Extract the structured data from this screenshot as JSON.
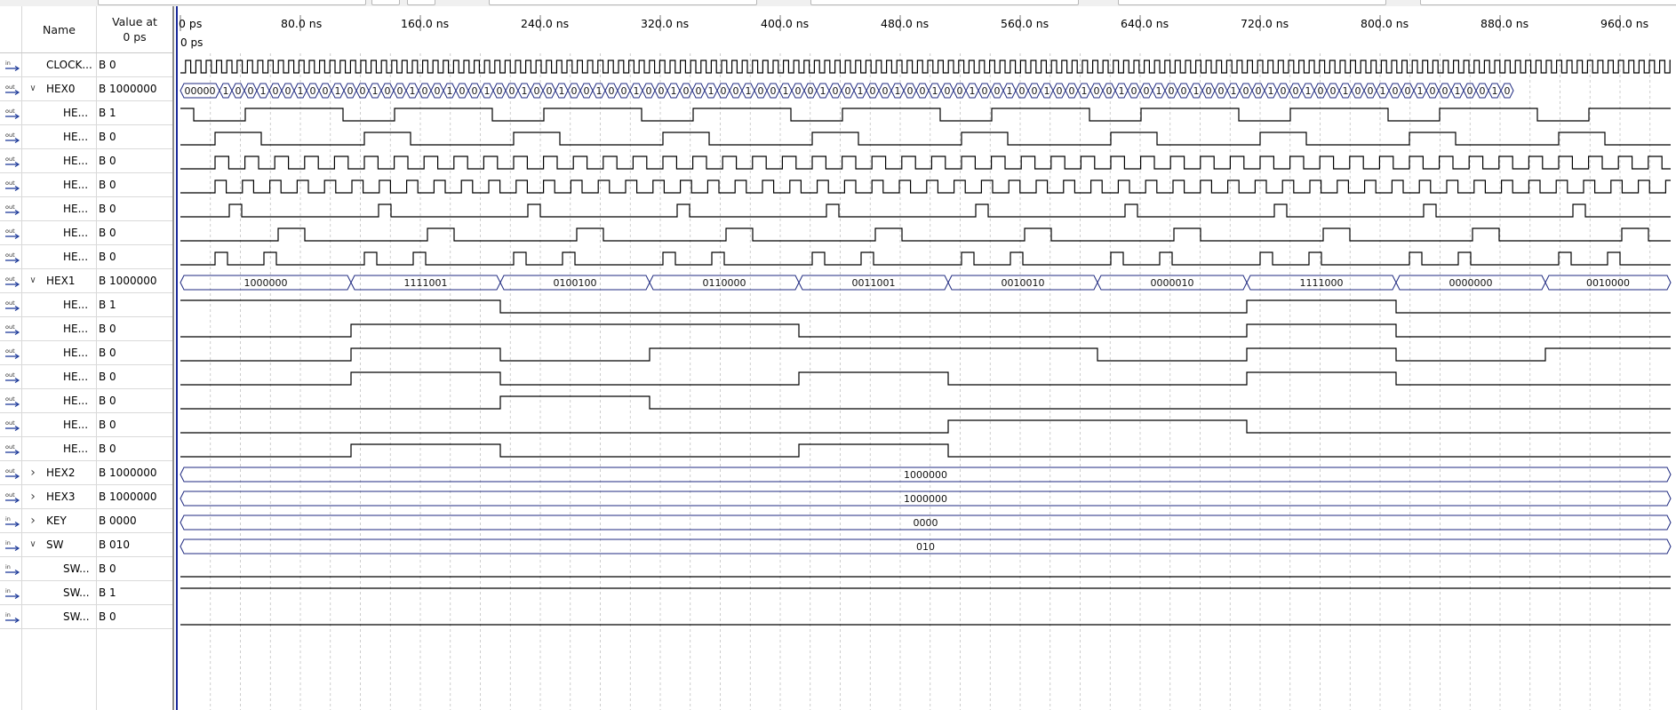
{
  "header": {
    "name_label": "Name",
    "value_label": "Value at\n0 ps"
  },
  "timeline": {
    "ticks": [
      "0 ps",
      "80.0 ns",
      "160.0 ns",
      "240.0 ns",
      "320.0 ns",
      "400.0 ns",
      "480.0 ns",
      "560.0 ns",
      "640.0 ns",
      "720.0 ns",
      "800.0 ns",
      "880.0 ns",
      "960.0 ns"
    ],
    "cursor_label": "0 ps"
  },
  "signals": [
    {
      "dir": "in",
      "name": "CLOCK...",
      "value": "B 0",
      "indent": 0
    },
    {
      "dir": "out",
      "name": "HEX0",
      "value": "B 1000000",
      "indent": 0,
      "expander": "down"
    },
    {
      "dir": "out",
      "name": "HE...",
      "value": "B 1",
      "indent": 1
    },
    {
      "dir": "out",
      "name": "HE...",
      "value": "B 0",
      "indent": 1
    },
    {
      "dir": "out",
      "name": "HE...",
      "value": "B 0",
      "indent": 1
    },
    {
      "dir": "out",
      "name": "HE...",
      "value": "B 0",
      "indent": 1
    },
    {
      "dir": "out",
      "name": "HE...",
      "value": "B 0",
      "indent": 1
    },
    {
      "dir": "out",
      "name": "HE...",
      "value": "B 0",
      "indent": 1
    },
    {
      "dir": "out",
      "name": "HE...",
      "value": "B 0",
      "indent": 1
    },
    {
      "dir": "out",
      "name": "HEX1",
      "value": "B 1000000",
      "indent": 0,
      "expander": "down"
    },
    {
      "dir": "out",
      "name": "HE...",
      "value": "B 1",
      "indent": 1
    },
    {
      "dir": "out",
      "name": "HE...",
      "value": "B 0",
      "indent": 1
    },
    {
      "dir": "out",
      "name": "HE...",
      "value": "B 0",
      "indent": 1
    },
    {
      "dir": "out",
      "name": "HE...",
      "value": "B 0",
      "indent": 1
    },
    {
      "dir": "out",
      "name": "HE...",
      "value": "B 0",
      "indent": 1
    },
    {
      "dir": "out",
      "name": "HE...",
      "value": "B 0",
      "indent": 1
    },
    {
      "dir": "out",
      "name": "HE...",
      "value": "B 0",
      "indent": 1
    },
    {
      "dir": "out",
      "name": "HEX2",
      "value": "B 1000000",
      "indent": 0,
      "expander": "right"
    },
    {
      "dir": "out",
      "name": "HEX3",
      "value": "B 1000000",
      "indent": 0,
      "expander": "right"
    },
    {
      "dir": "in",
      "name": "KEY",
      "value": "B 0000",
      "indent": 0,
      "expander": "right"
    },
    {
      "dir": "in",
      "name": "SW",
      "value": "B 010",
      "indent": 0,
      "expander": "down"
    },
    {
      "dir": "in",
      "name": "SW...",
      "value": "B 0",
      "indent": 1
    },
    {
      "dir": "in",
      "name": "SW...",
      "value": "B 1",
      "indent": 1
    },
    {
      "dir": "in",
      "name": "SW...",
      "value": "B 0",
      "indent": 1
    }
  ],
  "waveforms": {
    "hex0_bus_digits": [
      "00000",
      "1",
      "0",
      "0",
      "1",
      "0",
      "0",
      "1",
      "0",
      "0",
      "1",
      "0",
      "0",
      "1",
      "0",
      "0",
      "1",
      "0",
      "0",
      "1",
      "0",
      "0",
      "1",
      "0",
      "0",
      "1",
      "0",
      "0",
      "1",
      "0",
      "0",
      "1",
      "0",
      "0",
      "1",
      "0",
      "0",
      "1",
      "0",
      "0",
      "1",
      "0",
      "0",
      "1",
      "0",
      "0",
      "1",
      "0",
      "0",
      "1",
      "0",
      "0",
      "1",
      "0",
      "0",
      "1",
      "0",
      "0",
      "1",
      "0",
      "0",
      "1",
      "0",
      "0",
      "1",
      "0",
      "0",
      "1",
      "0",
      "0",
      "1",
      "0",
      "0",
      "1",
      "0",
      "0",
      "1",
      "0",
      "0",
      "1",
      "0",
      "0",
      "1",
      "0",
      "0",
      "1",
      "0",
      "0",
      "1",
      "0",
      "0",
      "1",
      "0",
      "0",
      "1",
      "0",
      "0",
      "1",
      "0",
      "0",
      "1",
      "0",
      "0",
      "1",
      "0"
    ],
    "hex1_bus_values": [
      "1000000",
      "1111001",
      "0100100",
      "0110000",
      "0011001",
      "0010010",
      "0000010",
      "1111000",
      "0000000",
      "0010000"
    ],
    "hex2_bus_value": "1000000",
    "hex3_bus_value": "1000000",
    "key_bus_value": "0000",
    "sw_bus_value": "010"
  },
  "colors": {
    "bus_line": "#1f2a80",
    "wave_line": "#000000",
    "grid": "#c0c0c0",
    "cursor": "#1a2a9a"
  }
}
